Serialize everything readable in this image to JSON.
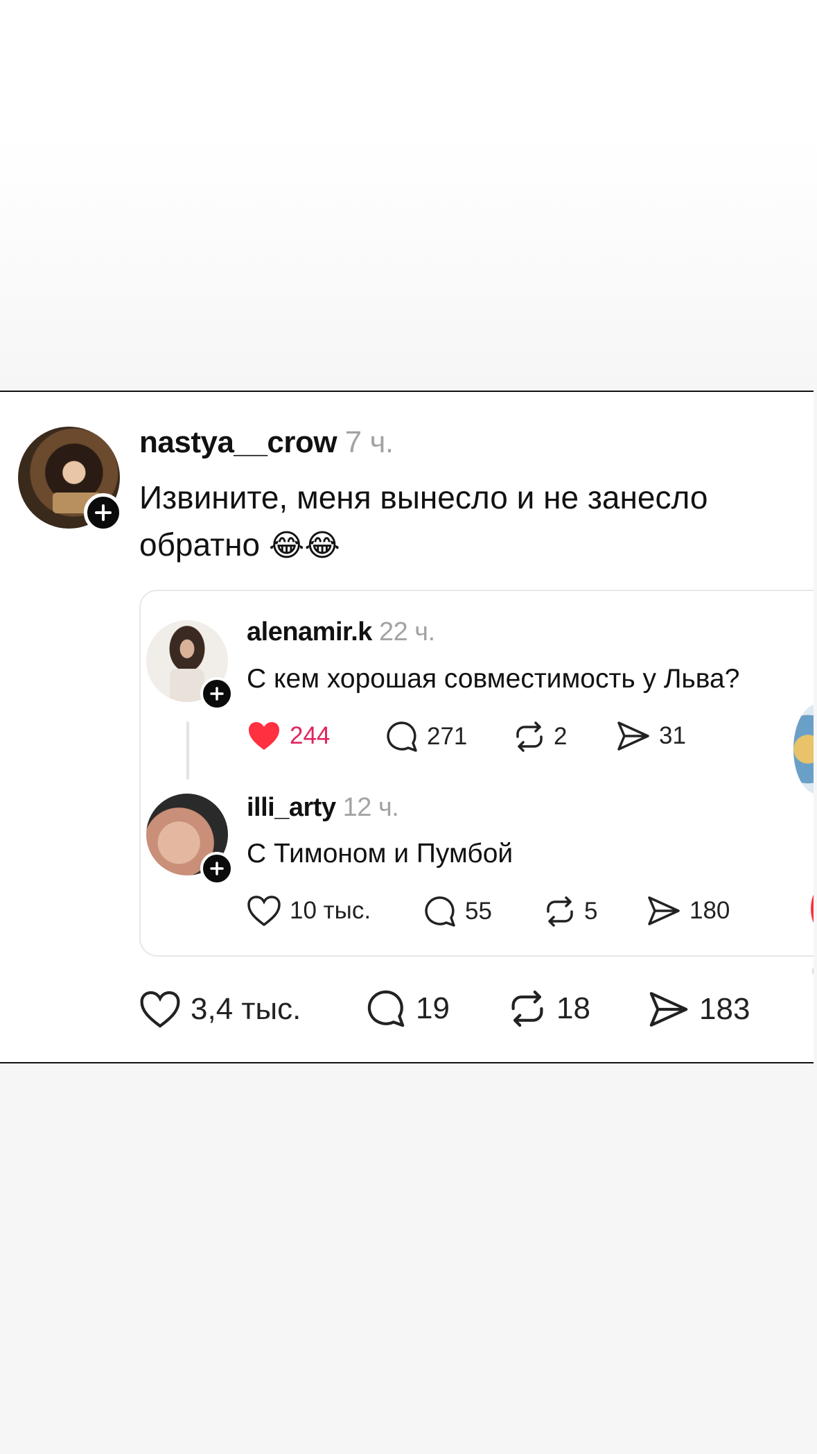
{
  "post": {
    "username": "nastya__crow",
    "time": "7 ч.",
    "text_line1": "Извините, меня вынесло и не занесло",
    "text_line2": "обратно",
    "emoji": "😂😂",
    "actions": {
      "likes": "3,4 тыс.",
      "comments": "19",
      "reposts": "18",
      "shares": "183"
    }
  },
  "quoted": {
    "original": {
      "username": "alenamir.k",
      "time": "22 ч.",
      "text": "С кем хорошая совместимость у Льва?",
      "actions": {
        "likes": "244",
        "comments": "271",
        "reposts": "2",
        "shares": "31"
      },
      "liked": true
    },
    "reply": {
      "username": "illi_arty",
      "time": "12 ч.",
      "text": "С Тимоном и Пумбой",
      "actions": {
        "likes": "10 тыс.",
        "comments": "55",
        "reposts": "5",
        "shares": "180"
      },
      "liked": false
    }
  },
  "colors": {
    "like_active": "#ff3040",
    "like_count_active": "#e0245e",
    "text": "#111111",
    "muted": "#a3a3a3",
    "border": "#e7e7e7"
  },
  "icons": [
    "heart-icon",
    "comment-icon",
    "repost-icon",
    "share-icon",
    "plus-icon"
  ]
}
